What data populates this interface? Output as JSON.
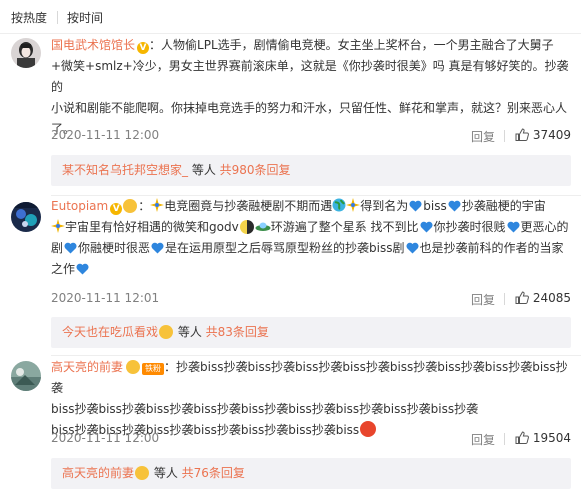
{
  "sort": {
    "hot": "按热度",
    "time": "按时间"
  },
  "comments": [
    {
      "user": "国电武术馆馆长",
      "sep": "：",
      "line1": "人物偷LPL选手，剧情偷电竞梗。女主坐上奖杯台，一个男主融合了大舅子",
      "line2": "+微笑+smlz+冷少，男女主世界赛前滚床单，这就是《你抄袭时很美》吗 真是有够好笑的。抄袭的",
      "line3": "小说和剧能不能爬啊。你抹掉电竞选手的努力和汗水，只留任性、鲜花和掌声，就这？别来恶心人",
      "line4": "了。",
      "time": "2020-11-11 12:00",
      "reply": "回复",
      "likes": "37409",
      "replies": {
        "who": "某不知名乌托邦空想家_",
        "mid": " 等人 ",
        "count": "共980条回复"
      }
    },
    {
      "user": "Eutopiam",
      "sep": "：",
      "p1": "电竞圈竟与抄袭融梗剧不期而遇",
      "p2": "得到名为",
      "p3": "biss",
      "p4": "抄袭融梗的宇宙",
      "p5": "宇宙里有恰好相遇的微笑和godv",
      "p6": "环游遍了整个星系 找不到比",
      "p7": "你抄袭时很贱",
      "p8": "更恶心的",
      "p9": "剧",
      "p10": "你融梗时很恶",
      "p11": "是在运用原型之后辱骂原型粉丝的抄袭biss剧",
      "p12": "也是抄袭前科的作者的当家",
      "p13": "之作",
      "time": "2020-11-11 12:01",
      "reply": "回复",
      "likes": "24085",
      "replies": {
        "who": "今天也在吃瓜看戏",
        "mid": " 等人 ",
        "count": "共83条回复"
      }
    },
    {
      "user": "高天亮的前妻",
      "badge": "铁粉",
      "sep": "：",
      "line1": "抄袭biss抄袭biss抄袭biss抄袭biss抄袭biss抄袭biss抄袭biss抄袭biss抄袭",
      "line2": "biss抄袭biss抄袭biss抄袭biss抄袭biss抄袭biss抄袭biss抄袭biss抄袭biss抄袭",
      "line3": "biss抄袭biss抄袭biss抄袭biss抄袭biss抄袭biss抄袭biss",
      "time": "2020-11-11 12:00",
      "reply": "回复",
      "likes": "19504",
      "replies": {
        "who": "高天亮的前妻",
        "mid": " 等人 ",
        "count": "共76条回复"
      }
    }
  ],
  "colors": {
    "username": "#eb7350",
    "heart": "#2e86de",
    "vip": "#f6b600"
  },
  "icons": [
    "v-badge-icon",
    "heart-icon",
    "thumb-up-icon",
    "sparkle-icon",
    "globe-icon",
    "emoji-face-icon"
  ]
}
